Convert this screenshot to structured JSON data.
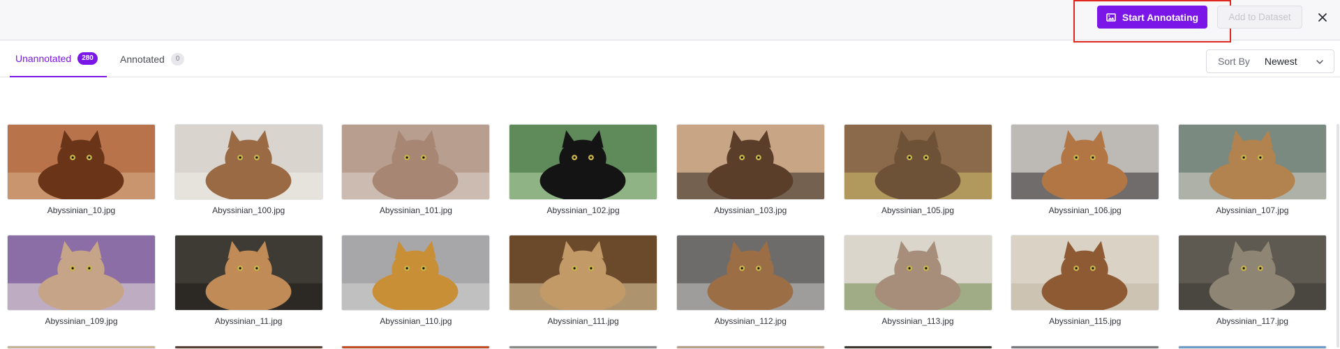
{
  "toolbar": {
    "start_label": "Start Annotating",
    "add_label": "Add to Dataset"
  },
  "tabs": [
    {
      "label": "Unannotated",
      "count": "280"
    },
    {
      "label": "Annotated",
      "count": "0"
    }
  ],
  "sort": {
    "label": "Sort By",
    "value": "Newest"
  },
  "icons": {
    "start": "image-icon",
    "close": "close-icon",
    "sort": "chevron-down-icon"
  },
  "colors": {
    "accent": "#7b16e8",
    "highlight": "#e0271f"
  },
  "images": [
    {
      "name": "Abyssinian_10.jpg",
      "bg": "#b8734a",
      "cat": "#6a3418",
      "accent": "#d6b08c"
    },
    {
      "name": "Abyssinian_100.jpg",
      "bg": "#d9d4cd",
      "cat": "#9a6a45",
      "accent": "#f1eee9"
    },
    {
      "name": "Abyssinian_101.jpg",
      "bg": "#b79e8f",
      "cat": "#a88674",
      "accent": "#ded4cc"
    },
    {
      "name": "Abyssinian_102.jpg",
      "bg": "#5f8a5a",
      "cat": "#141414",
      "accent": "#b7d6a8"
    },
    {
      "name": "Abyssinian_103.jpg",
      "bg": "#c8a585",
      "cat": "#5a3e2a",
      "accent": "#2f2a25"
    },
    {
      "name": "Abyssinian_105.jpg",
      "bg": "#8a6a4a",
      "cat": "#6e5238",
      "accent": "#d2c070"
    },
    {
      "name": "Abyssinian_106.jpg",
      "bg": "#bdb9b5",
      "cat": "#b27645",
      "accent": "#2f2e2d"
    },
    {
      "name": "Abyssinian_107.jpg",
      "bg": "#7a8a80",
      "cat": "#b2834f",
      "accent": "#d8d2c6"
    },
    {
      "name": "Abyssinian_109.jpg",
      "bg": "#8b6ea6",
      "cat": "#c6a487",
      "accent": "#e9e1d8"
    },
    {
      "name": "Abyssinian_11.jpg",
      "bg": "#3e3a34",
      "cat": "#c08b56",
      "accent": "#1d1c1a"
    },
    {
      "name": "Abyssinian_110.jpg",
      "bg": "#a7a7a9",
      "cat": "#c98f36",
      "accent": "#d7d6d5"
    },
    {
      "name": "Abyssinian_111.jpg",
      "bg": "#6b4a2c",
      "cat": "#c29a67",
      "accent": "#e6d2a6"
    },
    {
      "name": "Abyssinian_112.jpg",
      "bg": "#6e6c6a",
      "cat": "#9c6e45",
      "accent": "#c9c7c3"
    },
    {
      "name": "Abyssinian_113.jpg",
      "bg": "#dad6cc",
      "cat": "#a78e7a",
      "accent": "#6f8a4b"
    },
    {
      "name": "Abyssinian_115.jpg",
      "bg": "#d9d2c5",
      "cat": "#8e5a33",
      "accent": "#c2b6a4"
    },
    {
      "name": "Abyssinian_117.jpg",
      "bg": "#5e5a52",
      "cat": "#8f8574",
      "accent": "#3a3631"
    }
  ],
  "partial_row": [
    "#c7b393",
    "#5a4030",
    "#c24e22",
    "#8c8a86",
    "#b69f85",
    "#3d3830",
    "#7a7a78",
    "#6e9ec7"
  ]
}
